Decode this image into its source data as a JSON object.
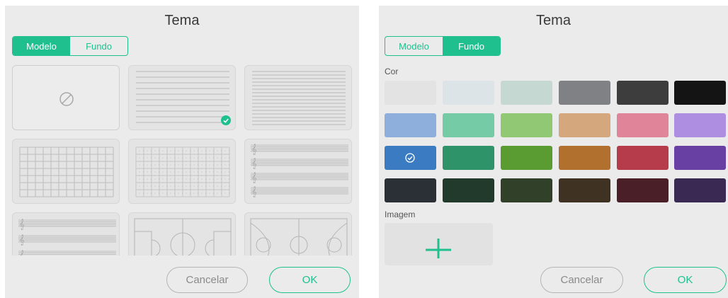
{
  "left": {
    "title": "Tema",
    "tabs": [
      {
        "label": "Modelo",
        "active": true
      },
      {
        "label": "Fundo",
        "active": false
      }
    ],
    "templates": [
      {
        "kind": "none",
        "icon": "no-symbol-icon",
        "selected": false
      },
      {
        "kind": "lined",
        "selected": true
      },
      {
        "kind": "lined-narrow",
        "selected": false
      },
      {
        "kind": "grid",
        "selected": false
      },
      {
        "kind": "dot-grid",
        "selected": false
      },
      {
        "kind": "music-staff",
        "selected": false
      },
      {
        "kind": "music-staff-wide",
        "selected": false
      },
      {
        "kind": "soccer-field",
        "selected": false
      },
      {
        "kind": "basketball-court",
        "selected": false
      }
    ],
    "cancel_label": "Cancelar",
    "ok_label": "OK"
  },
  "right": {
    "title": "Tema",
    "tabs": [
      {
        "label": "Modelo",
        "active": false
      },
      {
        "label": "Fundo",
        "active": true
      }
    ],
    "color_label": "Cor",
    "colors": [
      [
        "#e3e3e3",
        "#dde4e8",
        "#c5d9d2",
        "#808184",
        "#3d3d3d",
        "#141414"
      ],
      [
        "#8eafdb",
        "#74cba6",
        "#91c873",
        "#d4a87c",
        "#df8499",
        "#ad8ee0"
      ],
      [
        "#3a7bc2",
        "#2f936a",
        "#5a9c31",
        "#b2702e",
        "#b73c4b",
        "#6840a3"
      ],
      [
        "#2b2f36",
        "#213a2c",
        "#314029",
        "#403223",
        "#4b1f27",
        "#392953"
      ]
    ],
    "selected_color": "#3a7bc2",
    "image_label": "Imagem",
    "add_icon": "plus-icon",
    "cancel_label": "Cancelar",
    "ok_label": "OK"
  },
  "colors": {
    "accent": "#1fc08e",
    "panel_bg": "#ebebeb"
  }
}
